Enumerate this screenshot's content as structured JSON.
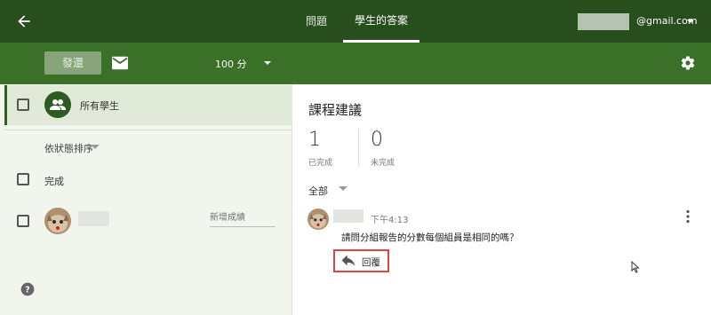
{
  "header": {
    "tabs": [
      {
        "label": "問題",
        "active": false
      },
      {
        "label": "學生的答案",
        "active": true
      }
    ],
    "account_email": "@gmail.com"
  },
  "toolbar": {
    "send_label": "發還",
    "points_label": "100 分"
  },
  "sidebar": {
    "all_students_label": "所有學生",
    "sort_label": "依狀態排序",
    "done_section_label": "完成",
    "grade_placeholder": "新增成績"
  },
  "assignment": {
    "title": "課程建議",
    "done_count": "1",
    "done_label": "已完成",
    "not_done_count": "0",
    "not_done_label": "未完成",
    "filter_label": "全部"
  },
  "comment": {
    "time": "下午4:13",
    "text": "請問分組報告的分數每個組員是相同的嗎？",
    "reply_label": "回覆"
  },
  "colors": {
    "header_bg": "#284e1e",
    "toolbar_bg": "#3a7028",
    "sidebar_bg": "#f1f5ed",
    "reply_highlight": "#e04545"
  },
  "icons": [
    "back-arrow-icon",
    "mail-icon",
    "settings-gear-icon",
    "people-group-icon",
    "help-icon",
    "more-vert-icon",
    "reply-arrow-icon",
    "mouse-cursor-icon"
  ]
}
